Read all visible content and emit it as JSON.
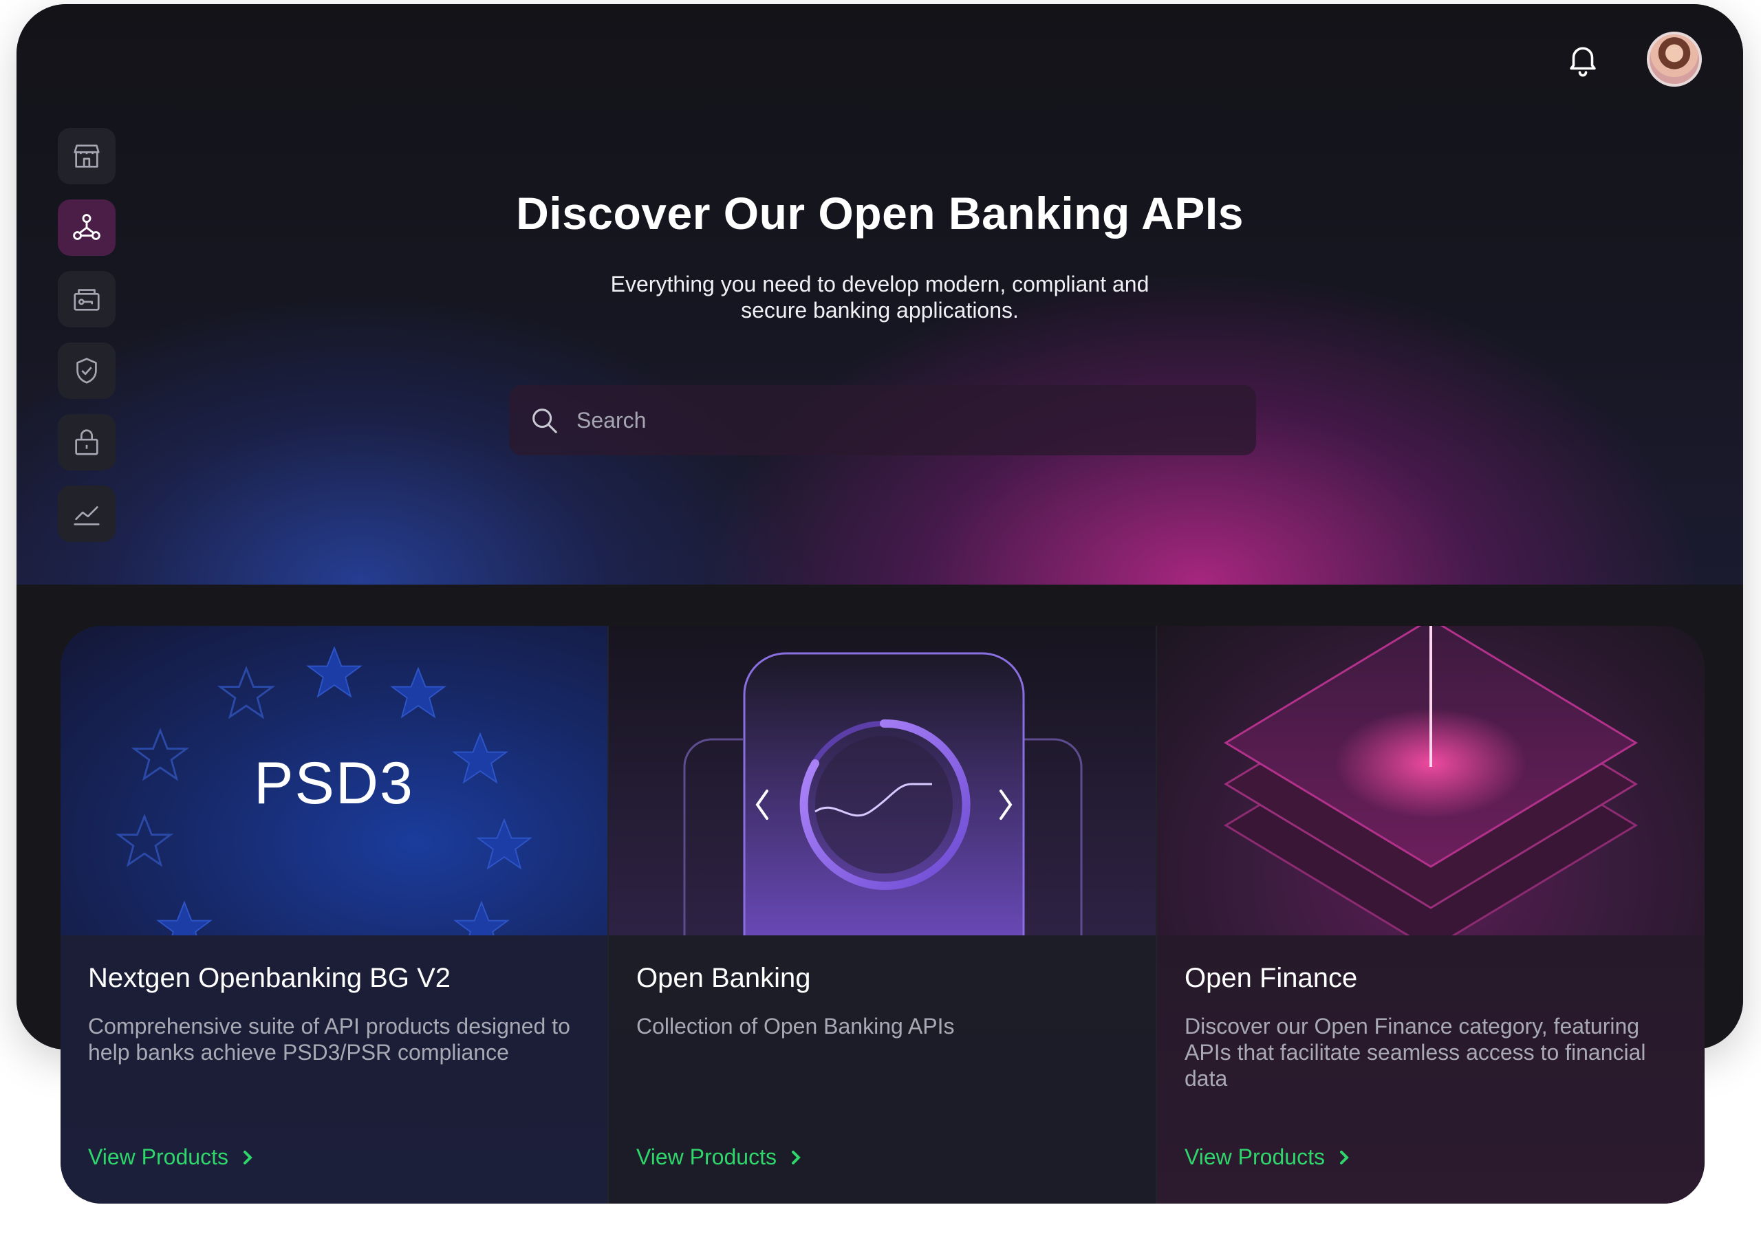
{
  "header": {
    "bell_icon": "bell-icon",
    "avatar": "user-avatar"
  },
  "sidebar": {
    "items": [
      {
        "icon": "store-icon",
        "active": false
      },
      {
        "icon": "network-icon",
        "active": true
      },
      {
        "icon": "card-key-icon",
        "active": false
      },
      {
        "icon": "shield-check-icon",
        "active": false
      },
      {
        "icon": "lock-icon",
        "active": false
      },
      {
        "icon": "chart-line-icon",
        "active": false
      }
    ]
  },
  "hero": {
    "title": "Discover Our Open Banking APIs",
    "subtitle_line1": "Everything you need to develop modern, compliant and",
    "subtitle_line2": "secure banking applications."
  },
  "search": {
    "placeholder": "Search"
  },
  "cards": [
    {
      "image_text": "PSD3",
      "title": "Nextgen Openbanking BG V2",
      "description": "Comprehensive suite of API products designed to help banks achieve PSD3/PSR compliance",
      "link_label": "View Products"
    },
    {
      "title": "Open Banking",
      "description": "Collection of Open Banking APIs",
      "link_label": "View Products"
    },
    {
      "title": "Open Finance",
      "description": "Discover our Open Finance category, featuring APIs that facilitate seamless access to financial data",
      "link_label": "View Products"
    }
  ],
  "colors": {
    "link_green": "#2fd66b",
    "active_sidebar": "#4b1e48"
  }
}
